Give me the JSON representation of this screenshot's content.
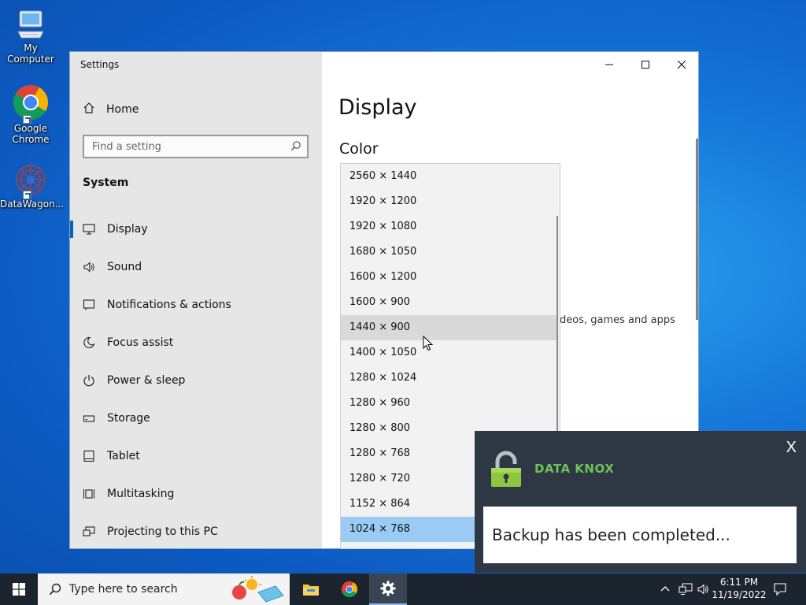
{
  "desktop": {
    "icons": [
      {
        "label": "My Computer"
      },
      {
        "label": "Google\nChrome"
      },
      {
        "label": "DataWagon..."
      }
    ]
  },
  "settings": {
    "window_title": "Settings",
    "home_label": "Home",
    "search_placeholder": "Find a setting",
    "section_heading": "System",
    "nav": [
      {
        "label": "Display",
        "icon": "monitor-icon",
        "active": true
      },
      {
        "label": "Sound",
        "icon": "speaker-icon"
      },
      {
        "label": "Notifications & actions",
        "icon": "notification-icon"
      },
      {
        "label": "Focus assist",
        "icon": "moon-icon"
      },
      {
        "label": "Power & sleep",
        "icon": "power-icon"
      },
      {
        "label": "Storage",
        "icon": "storage-icon"
      },
      {
        "label": "Tablet",
        "icon": "tablet-icon"
      },
      {
        "label": "Multitasking",
        "icon": "multitasking-icon"
      },
      {
        "label": "Projecting to this PC",
        "icon": "projecting-icon"
      }
    ],
    "page_title": "Display",
    "section_title": "Color",
    "partial_text": "deos, games and apps"
  },
  "resolution_dropdown": {
    "options": [
      "2560 × 1440",
      "1920 × 1200",
      "1920 × 1080",
      "1680 × 1050",
      "1600 × 1200",
      "1600 × 900",
      "1440 × 900",
      "1400 × 1050",
      "1280 × 1024",
      "1280 × 960",
      "1280 × 800",
      "1280 × 768",
      "1280 × 720",
      "1152 × 864",
      "1024 × 768"
    ],
    "hovered": "1440 × 900",
    "selected": "1024 × 768"
  },
  "toast": {
    "brand": "DATA KNOX",
    "close_label": "X",
    "message": "Backup has been completed...",
    "accent_color": "#6ec25a"
  },
  "taskbar": {
    "search_placeholder": "Type here to search",
    "time": "6:11 PM",
    "date": "11/19/2022"
  }
}
